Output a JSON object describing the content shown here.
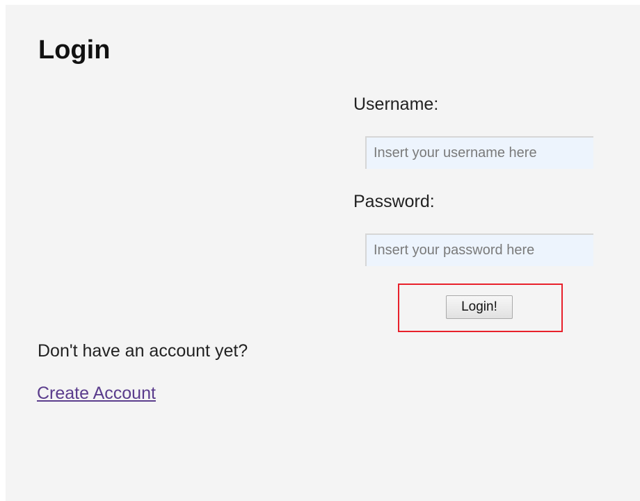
{
  "page": {
    "title": "Login"
  },
  "form": {
    "username_label": "Username:",
    "username_placeholder": "Insert your username here",
    "username_value": "",
    "password_label": "Password:",
    "password_placeholder": "Insert your password here",
    "password_value": "",
    "submit_label": "Login!"
  },
  "footer": {
    "prompt_text": "Don't have an account yet?",
    "create_account_link": "Create Account"
  },
  "colors": {
    "panel_background": "#f4f4f4",
    "input_background": "#edf4fd",
    "highlight_border": "#e8202a",
    "visited_link": "#5a3c8c"
  }
}
